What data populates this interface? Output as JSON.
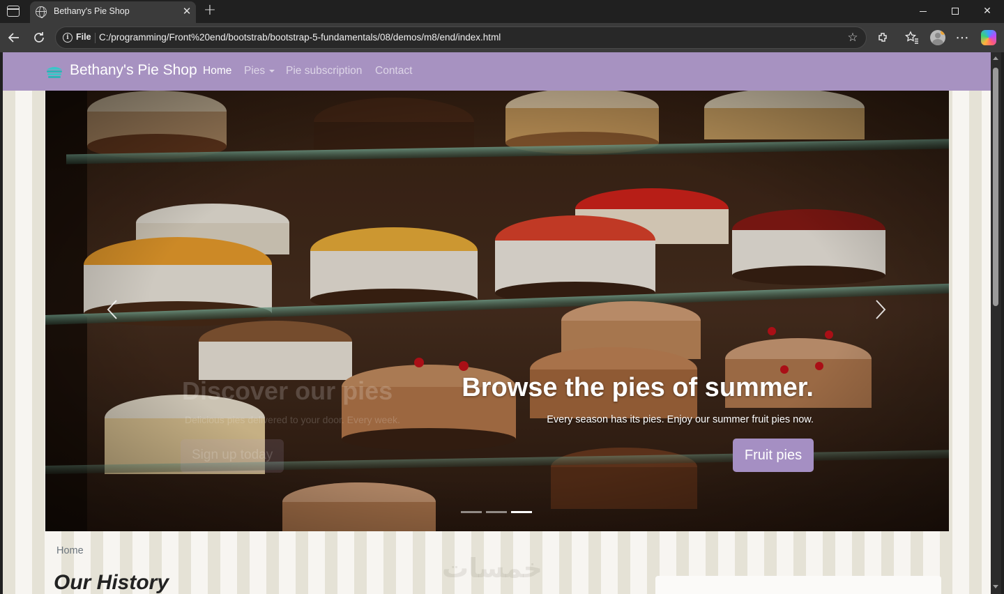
{
  "browser": {
    "tab_title": "Bethany's Pie Shop",
    "tab_close": "✕",
    "new_tab": "+",
    "address_label": "File",
    "url": "C:/programming/Front%20end/bootstrab/bootstrap-5-fundamentals/08/demos/m8/end/index.html",
    "toolbar_icons": [
      "back-arrow-icon",
      "reload-icon",
      "favorite-star-icon",
      "extensions-icon",
      "favorites-icon",
      "profile-avatar-icon",
      "more-icon",
      "copilot-icon"
    ]
  },
  "site": {
    "brand": "Bethany's Pie Shop",
    "nav": {
      "home": "Home",
      "pies": "Pies",
      "subscription": "Pie subscription",
      "contact": "Contact"
    },
    "colors": {
      "navbar": "#a792c1",
      "button": "#a58fc3",
      "stripe_dark": "#e5e2d6",
      "stripe_light": "#f7f5f1"
    }
  },
  "carousel": {
    "previous_slide": {
      "title": "Discover our pies",
      "text": "Delicious pies delivered to your door. Every week.",
      "button": "Sign up today"
    },
    "active_slide": {
      "title": "Browse the pies of summer.",
      "text": "Every season has its pies. Enjoy our summer fruit pies now.",
      "button": "Fruit pies"
    },
    "indicator_count": 3,
    "active_indicator": 3
  },
  "page": {
    "breadcrumb": "Home",
    "heading": "Our History",
    "watermark": "خمسات"
  }
}
